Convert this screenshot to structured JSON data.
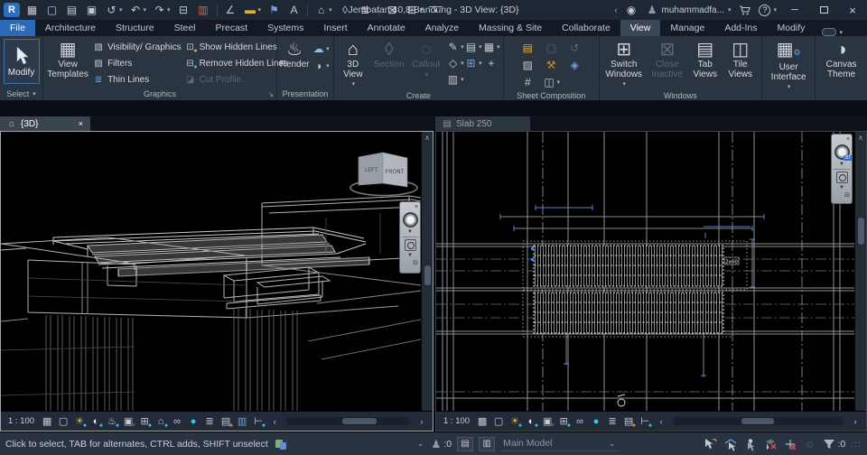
{
  "titlebar": {
    "logo": "R",
    "title": "Jembatan 40,8 Bandung - 3D View: {3D}",
    "user": "muhammadfa...",
    "text_tool_label": "A"
  },
  "ribbon_tabs": {
    "items": [
      {
        "label": "File"
      },
      {
        "label": "Architecture"
      },
      {
        "label": "Structure"
      },
      {
        "label": "Steel"
      },
      {
        "label": "Precast"
      },
      {
        "label": "Systems"
      },
      {
        "label": "Insert"
      },
      {
        "label": "Annotate"
      },
      {
        "label": "Analyze"
      },
      {
        "label": "Massing & Site"
      },
      {
        "label": "Collaborate"
      },
      {
        "label": "View"
      },
      {
        "label": "Manage"
      },
      {
        "label": "Add-Ins"
      },
      {
        "label": "Modify"
      }
    ],
    "active": "View"
  },
  "ribbon": {
    "select": {
      "modify": "Modify",
      "label": "Select"
    },
    "graphics": {
      "view_templates": "View Templates",
      "visibility": "Visibility/ Graphics",
      "filters": "Filters",
      "thin_lines": "Thin Lines",
      "show_hidden": "Show Hidden Lines",
      "remove_hidden": "Remove Hidden Lines",
      "cut_profile": "Cut Profile",
      "label": "Graphics"
    },
    "presentation": {
      "render": "Render",
      "label": "Presentation"
    },
    "create": {
      "view3d": "3D View",
      "section": "Section",
      "callout": "Callout",
      "label": "Create"
    },
    "sheet_composition": {
      "label": "Sheet Composition",
      "guide_grid_glyph": "#"
    },
    "windows": {
      "switch_windows": "Switch Windows",
      "close_inactive": "Close Inactive",
      "tab_views": "Tab Views",
      "tile_views": "Tile Views",
      "user_interface": "User Interface",
      "canvas_theme": "Canvas Theme",
      "label": "Windows"
    }
  },
  "view_tabs": {
    "left": "{3D}",
    "right": "Slab 250"
  },
  "left_viewport": {
    "scale": "1 : 100",
    "viewcube": {
      "front": "FRONT",
      "left": "LEFT"
    }
  },
  "right_viewport": {
    "scale": "1 : 100",
    "tag": "2x60",
    "nav_badge": "2D"
  },
  "statusbar": {
    "message": "Click to select, TAB for alternates, CTRL adds, SHIFT unselect",
    "editing_requests_count": ":0",
    "design_option": "Main Model",
    "filter_count": ":0"
  },
  "colors": {
    "accent_blue": "#2a6fc2",
    "dim_blue": "#5585d6",
    "cyan": "#35c7e8",
    "red": "#e34b4b",
    "amber": "#d9b23c"
  }
}
